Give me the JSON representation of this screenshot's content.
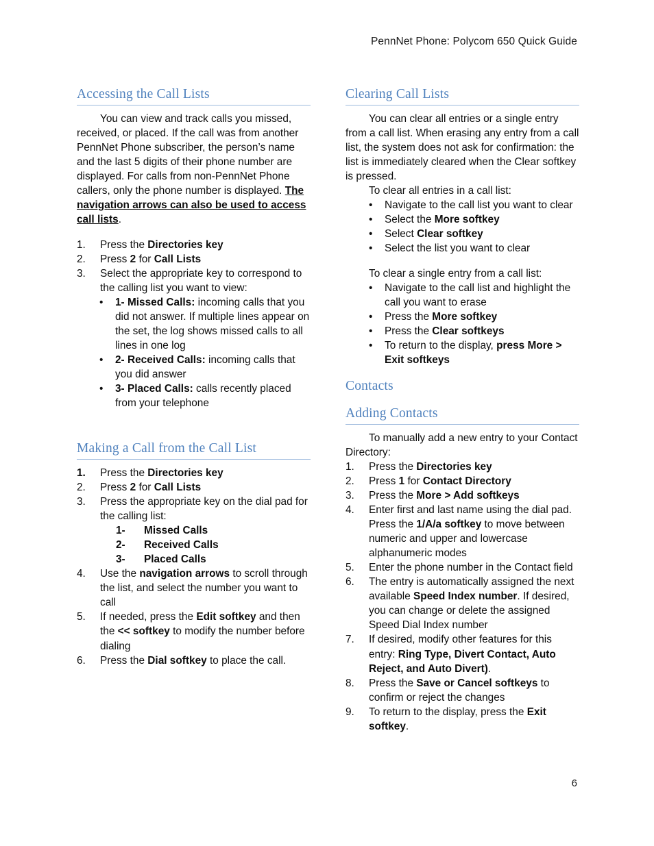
{
  "header": {
    "title": "PennNet Phone: Polycom 650 Quick Guide"
  },
  "page_number": "6",
  "bullet_glyph": "•",
  "colors": {
    "heading": "#4F81BD",
    "heading_rule": "#9CB9DD",
    "body_text": "#0D0D0D"
  },
  "left_column": {
    "section1": {
      "heading": "Accessing the Call Lists",
      "paragraph": {
        "part1": "You can view and track calls you missed, received, or placed. If the call was from another PennNet Phone subscriber, the person’s name and the last 5 digits of their phone number are displayed. For calls from non-PennNet Phone callers, only the phone number is displayed. ",
        "emphasis": "The navigation arrows can also be used to access call lists",
        "part2": "."
      },
      "steps": [
        {
          "marker": "1.",
          "pre": "Press the ",
          "bold": "Directories key",
          "post": ""
        },
        {
          "marker": "2.",
          "pre": "Press ",
          "bold": "2",
          "mid": " for ",
          "bold2": "Call Lists",
          "post": ""
        },
        {
          "marker": "3.",
          "pre": "Select the appropriate key to correspond to the calling list you want to view:",
          "bold": "",
          "post": ""
        }
      ],
      "sub_bullets": [
        {
          "bold": "1- Missed Calls:",
          "text": "  incoming calls that you did not answer. If multiple lines appear on the set, the log shows missed calls to all lines in one log"
        },
        {
          "bold": "2- Received Calls:",
          "text": " incoming calls that you did answer"
        },
        {
          "bold": "3- Placed Calls:",
          "text": " calls recently placed from your telephone"
        }
      ]
    },
    "section2": {
      "heading": "Making a Call from the Call List",
      "steps": [
        {
          "marker": "1.",
          "marker_bold": true,
          "pre": "Press the ",
          "bold": "Directories key",
          "post": ""
        },
        {
          "marker": "2.",
          "marker_bold": false,
          "pre": "Press ",
          "bold": "2",
          "mid": " for ",
          "bold2": "Call Lists",
          "post": ""
        },
        {
          "marker": "3.",
          "marker_bold": false,
          "pre": "Press the appropriate key on the dial pad for the calling list:",
          "bold": "",
          "post": ""
        }
      ],
      "call_list_types": [
        {
          "marker": "1-",
          "label": "Missed Calls"
        },
        {
          "marker": "2-",
          "label": "Received Calls"
        },
        {
          "marker": "3-",
          "label": "Placed Calls"
        }
      ],
      "steps_cont": [
        {
          "marker": "4.",
          "pre": "Use the ",
          "bold": "navigation arrows",
          "post": " to scroll through the list, and select the number you want to call"
        },
        {
          "marker": "5.",
          "pre": "If needed, press the ",
          "bold": "Edit softkey",
          "mid": " and then the ",
          "bold2": "<< softkey",
          "post": " to modify the number before dialing"
        },
        {
          "marker": "6.",
          "pre": "Press the ",
          "bold": "Dial softkey",
          "post": " to place the call."
        }
      ]
    }
  },
  "right_column": {
    "section1": {
      "heading": "Clearing Call Lists",
      "paragraph": "You can clear all entries or a single entry from a call list.  When erasing any entry from a call list, the system does not ask for confirmation: the list is immediately cleared when the Clear softkey is pressed.",
      "lead_in_all": "To clear all entries in a call list:",
      "bullets_all": [
        {
          "pre": "Navigate to the call list you want to clear",
          "bold": "",
          "post": ""
        },
        {
          "pre": "Select the ",
          "bold": "More softkey",
          "post": ""
        },
        {
          "pre": "Select ",
          "bold": "Clear softkey",
          "post": ""
        },
        {
          "pre": "Select the list you want to clear",
          "bold": "",
          "post": ""
        }
      ],
      "lead_in_single": "To clear a single entry from a call list:",
      "bullets_single": [
        {
          "pre": "Navigate to the call list and highlight the call you want to erase",
          "bold": "",
          "post": ""
        },
        {
          "pre": "Press the ",
          "bold": "More softkey",
          "post": ""
        },
        {
          "pre": "Press the ",
          "bold": "Clear softkeys",
          "post": ""
        },
        {
          "pre": "To return to the display, ",
          "bold": "press More > Exit softkeys",
          "post": ""
        }
      ]
    },
    "section2": {
      "heading": "Contacts"
    },
    "section3": {
      "heading": "Adding Contacts",
      "paragraph": "To manually add a new entry to your Contact Directory:",
      "steps": [
        {
          "marker": "1.",
          "pre": "Press the ",
          "bold": "Directories key",
          "post": ""
        },
        {
          "marker": "2.",
          "pre": "Press ",
          "bold": "1",
          "mid": " for ",
          "bold2": "Contact Directory",
          "post": ""
        },
        {
          "marker": "3.",
          "pre": "Press the ",
          "bold": "More > Add softkeys",
          "post": ""
        },
        {
          "marker": "4.",
          "pre": "Enter first and last name using the dial pad. Press the ",
          "bold": "1/A/a softkey",
          "post": " to move between numeric and upper and lowercase alphanumeric modes"
        },
        {
          "marker": "5.",
          "pre": "Enter the phone number in the Contact field",
          "bold": "",
          "post": ""
        },
        {
          "marker": "6.",
          "pre": "The entry is automatically assigned the next available ",
          "bold": "Speed Index number",
          "post": ".  If desired, you can change or delete the assigned Speed Dial Index number"
        },
        {
          "marker": "7.",
          "pre": "If desired, modify other features for this entry: ",
          "bold": "Ring Type, Divert Contact, Auto Reject, and Auto Divert)",
          "post": "."
        },
        {
          "marker": "8.",
          "pre": "Press the ",
          "bold": "Save or Cancel softkeys",
          "post": " to confirm or reject the changes"
        },
        {
          "marker": "9.",
          "pre": "To return to the display, press the ",
          "bold": "Exit softkey",
          "post": "."
        }
      ]
    }
  }
}
